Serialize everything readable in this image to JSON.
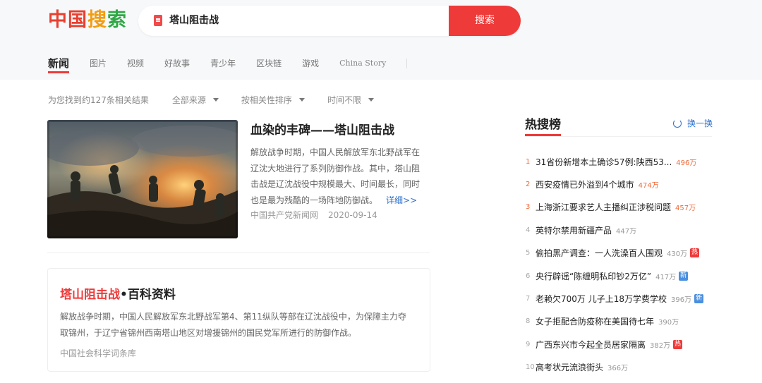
{
  "logo": {
    "chars": [
      "中",
      "国",
      "搜",
      "索"
    ]
  },
  "search": {
    "query": "塔山阻击战",
    "button_label": "搜索"
  },
  "tabs": [
    {
      "label": "新闻",
      "active": true
    },
    {
      "label": "图片"
    },
    {
      "label": "视频"
    },
    {
      "label": "好故事"
    },
    {
      "label": "青少年"
    },
    {
      "label": "区块链"
    },
    {
      "label": "游戏"
    },
    {
      "label": "China Story"
    }
  ],
  "filters": {
    "result_count": "为您找到约127条相关结果",
    "source": "全部来源",
    "sort": "按相关性排序",
    "time": "时间不限"
  },
  "news_item": {
    "title": "血染的丰碑——塔山阻击战",
    "summary": "解放战争时期，中国人民解放军东北野战军在辽沈大地进行了系列防御作战。其中，塔山阻击战是辽沈战役中规模最大、时间最长，同时也是最为残酷的一场阵地防御战。",
    "more_link": "详细>>",
    "source": "中国共产党新闻网",
    "date": "2020-09-14"
  },
  "baike": {
    "title_highlight": "塔山阻击战",
    "title_suffix": "•百科资料",
    "description": "解放战争时期，中国人民解放军东北野战军第4、第11纵队等部在辽沈战役中，为保障主力夺取锦州，于辽宁省锦州西南塔山地区对增援锦州的国民党军所进行的防御作战。",
    "source": "中国社会科学词条库"
  },
  "hot": {
    "title": "热搜榜",
    "refresh_label": "换一换",
    "items": [
      {
        "rank": "1",
        "text": "31省份新增本土确诊57例:陕西53...",
        "heat": "496万",
        "badge": ""
      },
      {
        "rank": "2",
        "text": "西安疫情已外溢到4个城市",
        "heat": "474万",
        "badge": ""
      },
      {
        "rank": "3",
        "text": "上海浙江要求艺人主播纠正涉税问题",
        "heat": "457万",
        "badge": ""
      },
      {
        "rank": "4",
        "text": "英特尔禁用新疆产品",
        "heat": "447万",
        "badge": ""
      },
      {
        "rank": "5",
        "text": "偷拍黑产调查：一人洗澡百人围观",
        "heat": "430万",
        "badge": "热"
      },
      {
        "rank": "6",
        "text": "央行辟谣“陈缠明私印钞2万亿”",
        "heat": "417万",
        "badge": "新"
      },
      {
        "rank": "7",
        "text": "老赖欠700万 儿子上18万学费学校",
        "heat": "396万",
        "badge": "新"
      },
      {
        "rank": "8",
        "text": "女子拒配合防疫称在美国待七年",
        "heat": "390万",
        "badge": ""
      },
      {
        "rank": "9",
        "text": "广西东兴市今起全员居家隔离",
        "heat": "382万",
        "badge": "热"
      },
      {
        "rank": "10",
        "text": "高考状元流浪街头",
        "heat": "366万",
        "badge": ""
      }
    ]
  },
  "colors": {
    "accent": "#ef3a3a",
    "link": "#2b6fce",
    "rank_top": "#ef6a3a"
  }
}
